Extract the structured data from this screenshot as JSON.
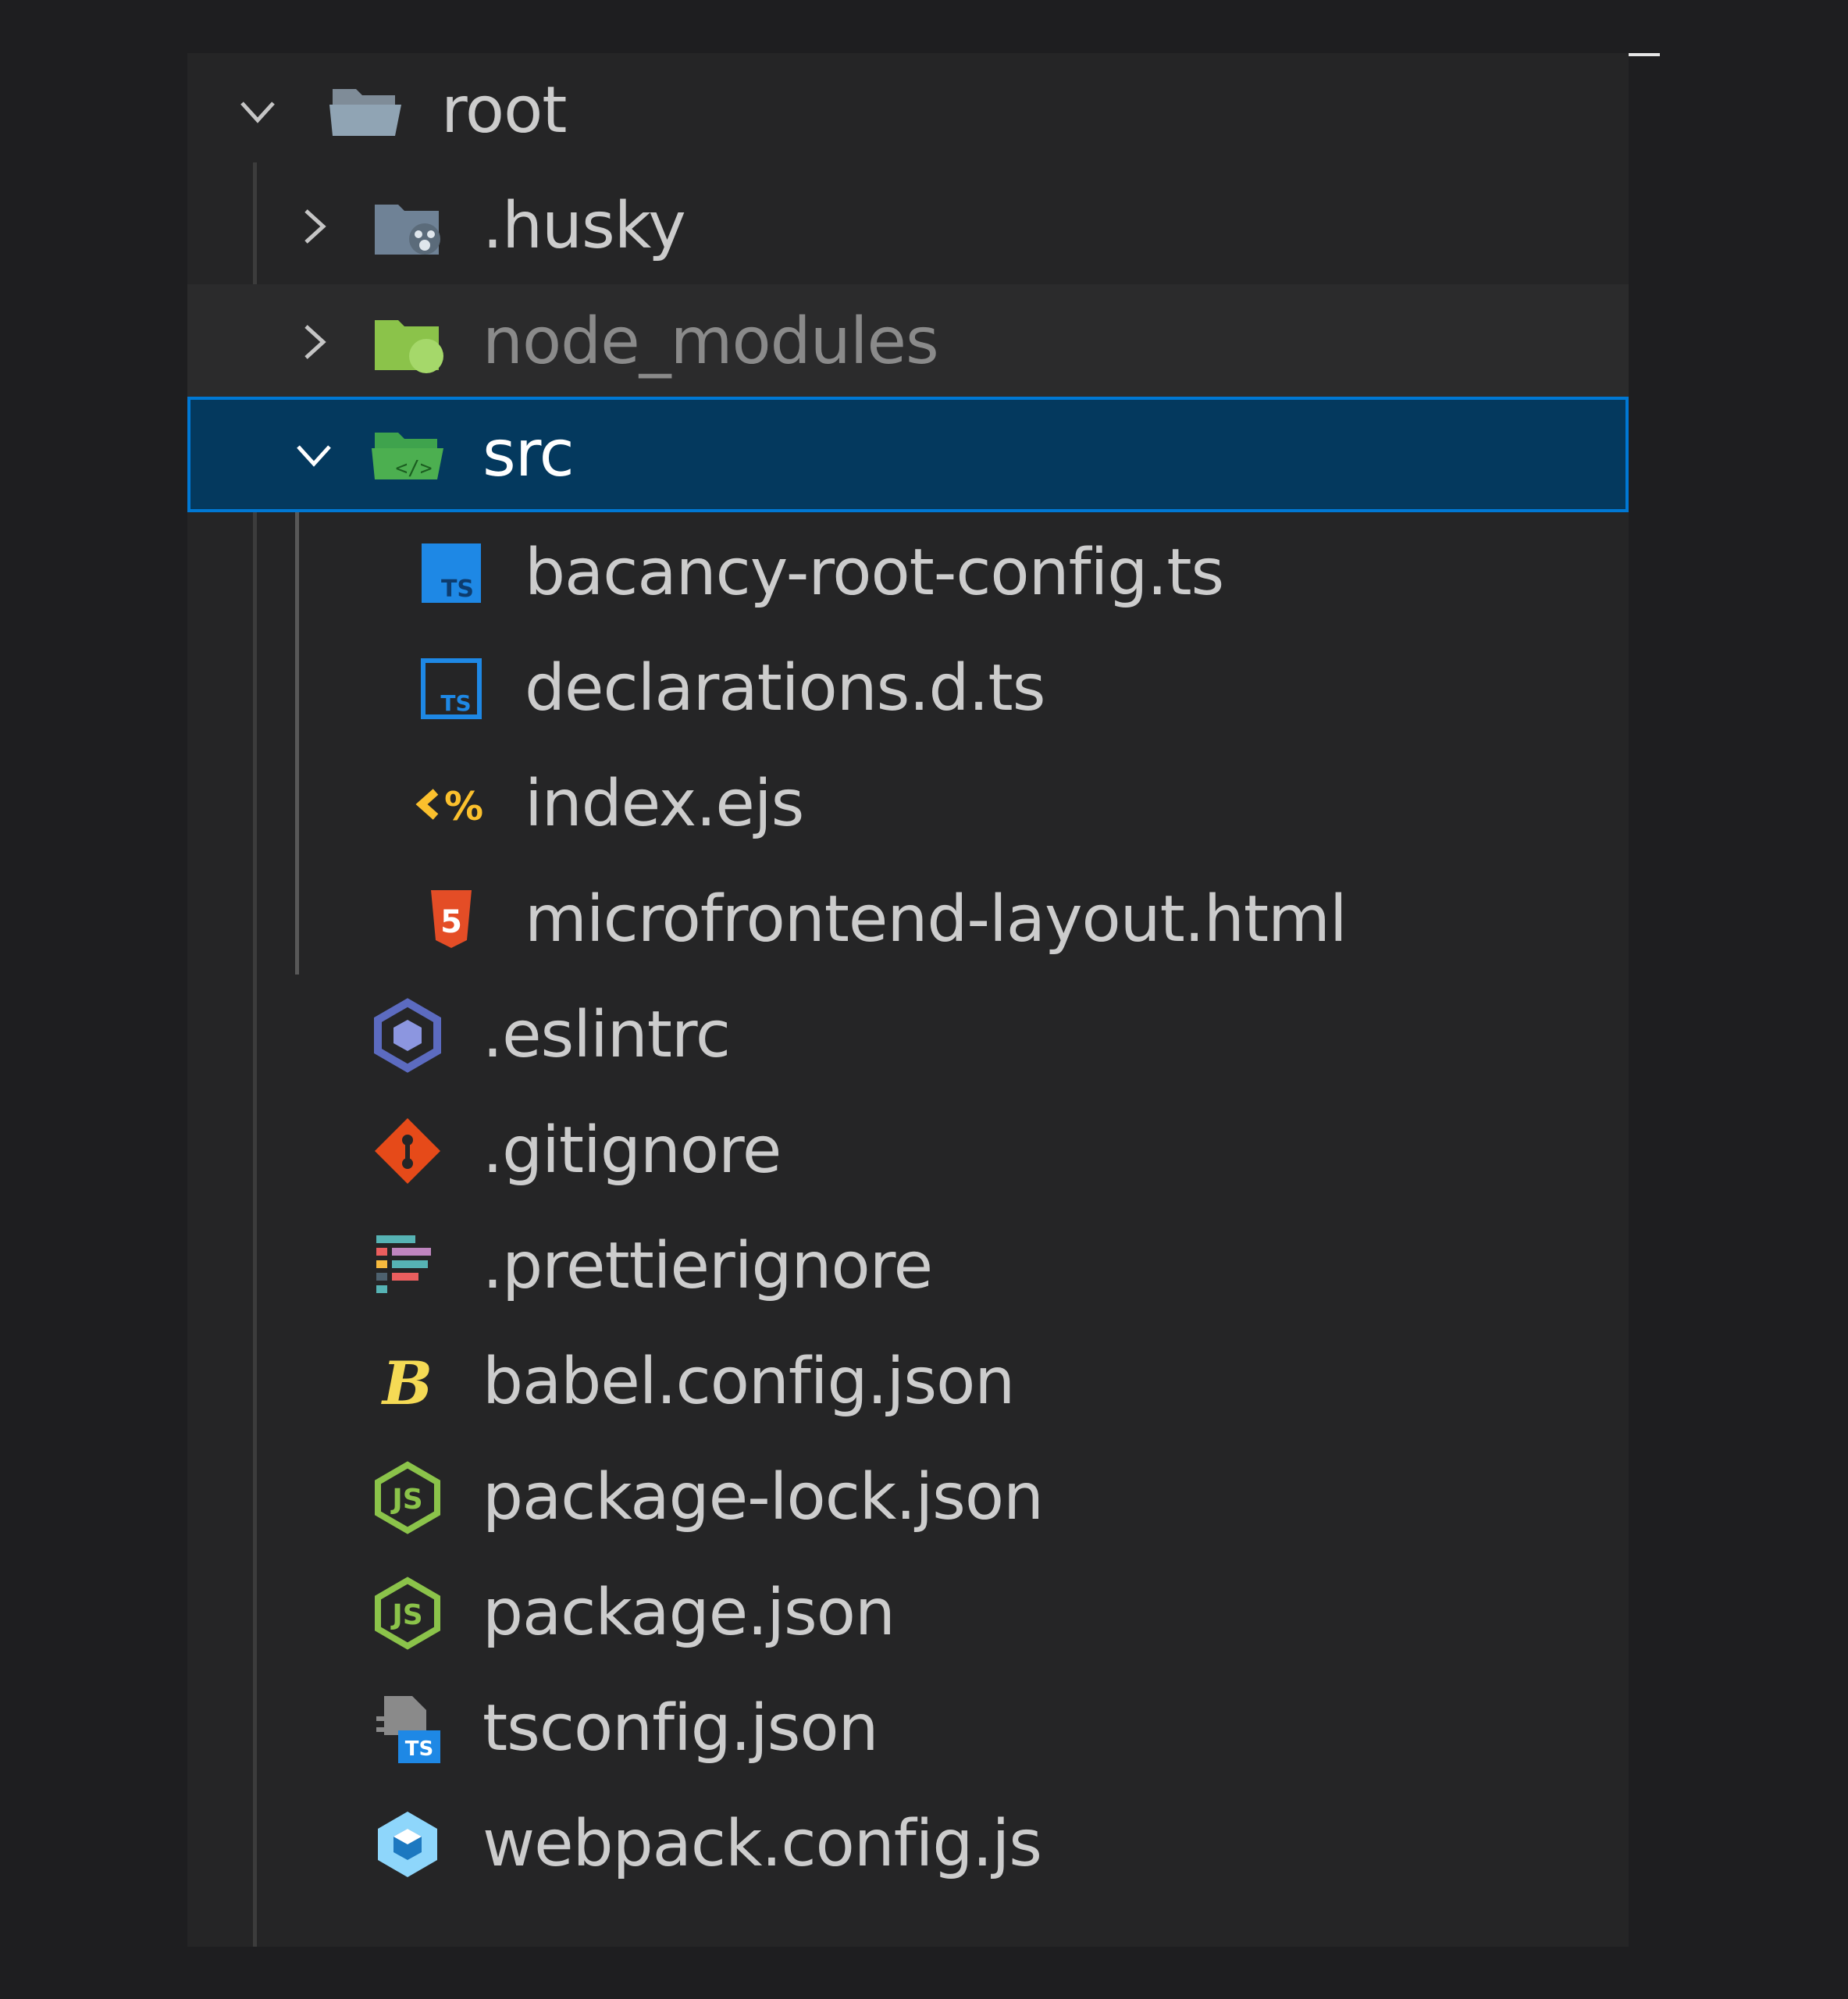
{
  "tree": {
    "root": {
      "label": "root",
      "expanded": true
    },
    "folders": [
      {
        "label": ".husky",
        "expanded": false,
        "icon": "husky-folder-icon"
      },
      {
        "label": "node_modules",
        "expanded": false,
        "icon": "node-folder-icon"
      },
      {
        "label": "src",
        "expanded": true,
        "selected": true,
        "icon": "src-folder-icon"
      }
    ],
    "src_files": [
      {
        "label": "bacancy-root-config.ts",
        "icon": "typescript-icon"
      },
      {
        "label": "declarations.d.ts",
        "icon": "typescript-def-icon"
      },
      {
        "label": "index.ejs",
        "icon": "ejs-icon"
      },
      {
        "label": "microfrontend-layout.html",
        "icon": "html5-icon"
      }
    ],
    "root_files": [
      {
        "label": ".eslintrc",
        "icon": "eslint-icon"
      },
      {
        "label": ".gitignore",
        "icon": "git-icon"
      },
      {
        "label": ".prettierignore",
        "icon": "prettier-icon"
      },
      {
        "label": "babel.config.json",
        "icon": "babel-icon"
      },
      {
        "label": "package-lock.json",
        "icon": "nodejs-icon"
      },
      {
        "label": "package.json",
        "icon": "nodejs-icon"
      },
      {
        "label": "tsconfig.json",
        "icon": "tsconfig-icon"
      },
      {
        "label": "webpack.config.js",
        "icon": "webpack-icon"
      }
    ]
  },
  "colors": {
    "background": "#1e1e20",
    "panel": "#252526",
    "selection": "#04395e",
    "selection_border": "#0078d4",
    "text": "#cccccc",
    "text_dim": "#8a8a8a"
  }
}
